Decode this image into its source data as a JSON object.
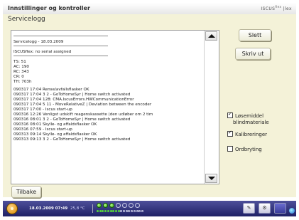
{
  "header": {
    "title": "Innstillinger og kontroller",
    "brand": "ISCUS",
    "brand_sup": "flex",
    "brand_suffix": "|lex"
  },
  "panel": {
    "title": "Servicelogg"
  },
  "log": {
    "header_line": "Servicelogg - 18.03.2009",
    "device_line": "ISCUSflex: no serial assigned",
    "stats": [
      "TS: 51",
      "AC: 190",
      "RC: 343",
      "CR: 0",
      "TH: 703h"
    ],
    "entries": [
      "090317 17:04 Rense/avfallsflasker OK",
      "090317 17:04 3 2 - GoToHomeSyr | Home switch activated",
      "090317 17:04 128: CMA.IscusErrors.HWCommunicationError",
      "090317 17:04 5 11 - MoveRelativeZ | Deviation between the encoder",
      "090317 17:00 - Iscus start-up",
      "090316 12:26 Venligst udskift reagenskassette (den udløber om 2 tim",
      "090316 08:01 3 2 - GoToHomeSyr | Home switch activated",
      "090316 08:01 Skylle- og affaldsflasker OK",
      "090316 07:59 - Iscus start-up",
      "090313 09:14 Skylle- og affaldsflasker OK",
      "090313 09:13 3 2 - GoToHomeSyr | Home switch activated"
    ]
  },
  "buttons": {
    "slett": "Slett",
    "skriv_ut": "Skriv ut",
    "tilbake": "Tilbake"
  },
  "checkboxes": {
    "losemiddel": {
      "label": "Løsemiddel",
      "label2": "blindmateriale",
      "checked": true
    },
    "kalibreringer": {
      "label": "Kalibreringer",
      "checked": true
    },
    "ordbryting": {
      "label": "Ordbryting",
      "checked": false
    }
  },
  "taskbar": {
    "datetime": "18.03.2009 07:49",
    "temperature": "25,8 °C",
    "indicators_top": [
      "g",
      "g",
      "g",
      "o",
      "o",
      "o",
      "o"
    ],
    "indicators_bottom": [
      "g",
      "g",
      "g",
      "g",
      "g",
      "g",
      "g",
      "g",
      "g",
      "o",
      "o",
      "o",
      "o",
      "o",
      "o",
      "o",
      "o",
      "o"
    ]
  },
  "icons": {
    "power": "power-icon",
    "wrench": "wrench-icon",
    "gear": "gear-icon",
    "window": "window-icon",
    "network": "network-icon"
  },
  "colors": {
    "panel_bg": "#f4f2d8",
    "taskbar_top": "#4d4f9a",
    "taskbar_bottom": "#1f2166",
    "status_green": "#55d43b"
  }
}
